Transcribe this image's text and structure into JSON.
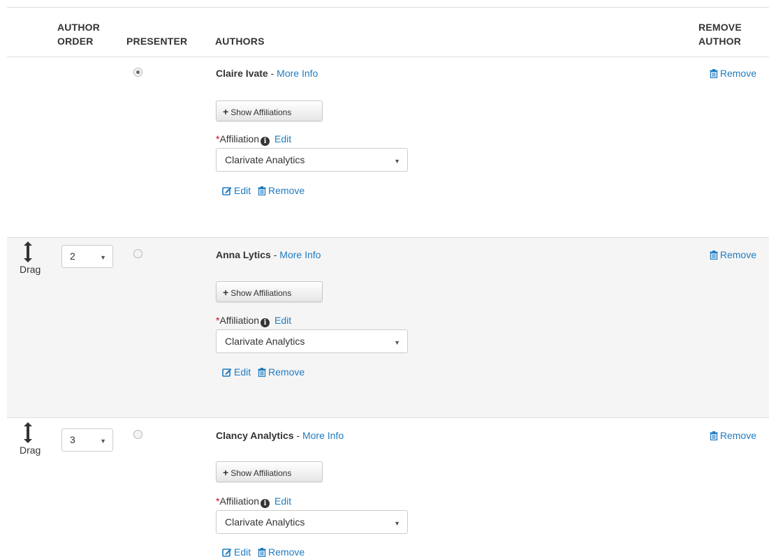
{
  "header": {
    "author_order_line1": "AUTHOR",
    "author_order_line2": "ORDER",
    "presenter": "PRESENTER",
    "authors": "AUTHORS",
    "remove_author_line1": "REMOVE",
    "remove_author_line2": "AUTHOR"
  },
  "common": {
    "more_info": "More Info",
    "separator": " - ",
    "show_affiliations": "Show Affiliations",
    "affiliation_required_mark": "*",
    "affiliation_label": "Affiliation",
    "affiliation_edit": "Edit",
    "edit": "Edit",
    "remove": "Remove",
    "drag": "Drag"
  },
  "authors": [
    {
      "name": "Claire Ivate",
      "presenter": true,
      "order": "",
      "affiliation": "Clarivate Analytics"
    },
    {
      "name": "Anna Lytics",
      "presenter": false,
      "order": "2",
      "affiliation": "Clarivate Analytics"
    },
    {
      "name": "Clancy Analytics",
      "presenter": false,
      "order": "3",
      "affiliation": "Clarivate Analytics"
    }
  ],
  "colors": {
    "link": "#1f7bc0",
    "required": "#d0021b",
    "row_alt": "#f5f5f5",
    "border": "#dddddd"
  },
  "icons": [
    "drag-vertical-icon",
    "plus-icon",
    "info-icon",
    "edit-icon",
    "trash-icon",
    "caret-down-icon"
  ]
}
